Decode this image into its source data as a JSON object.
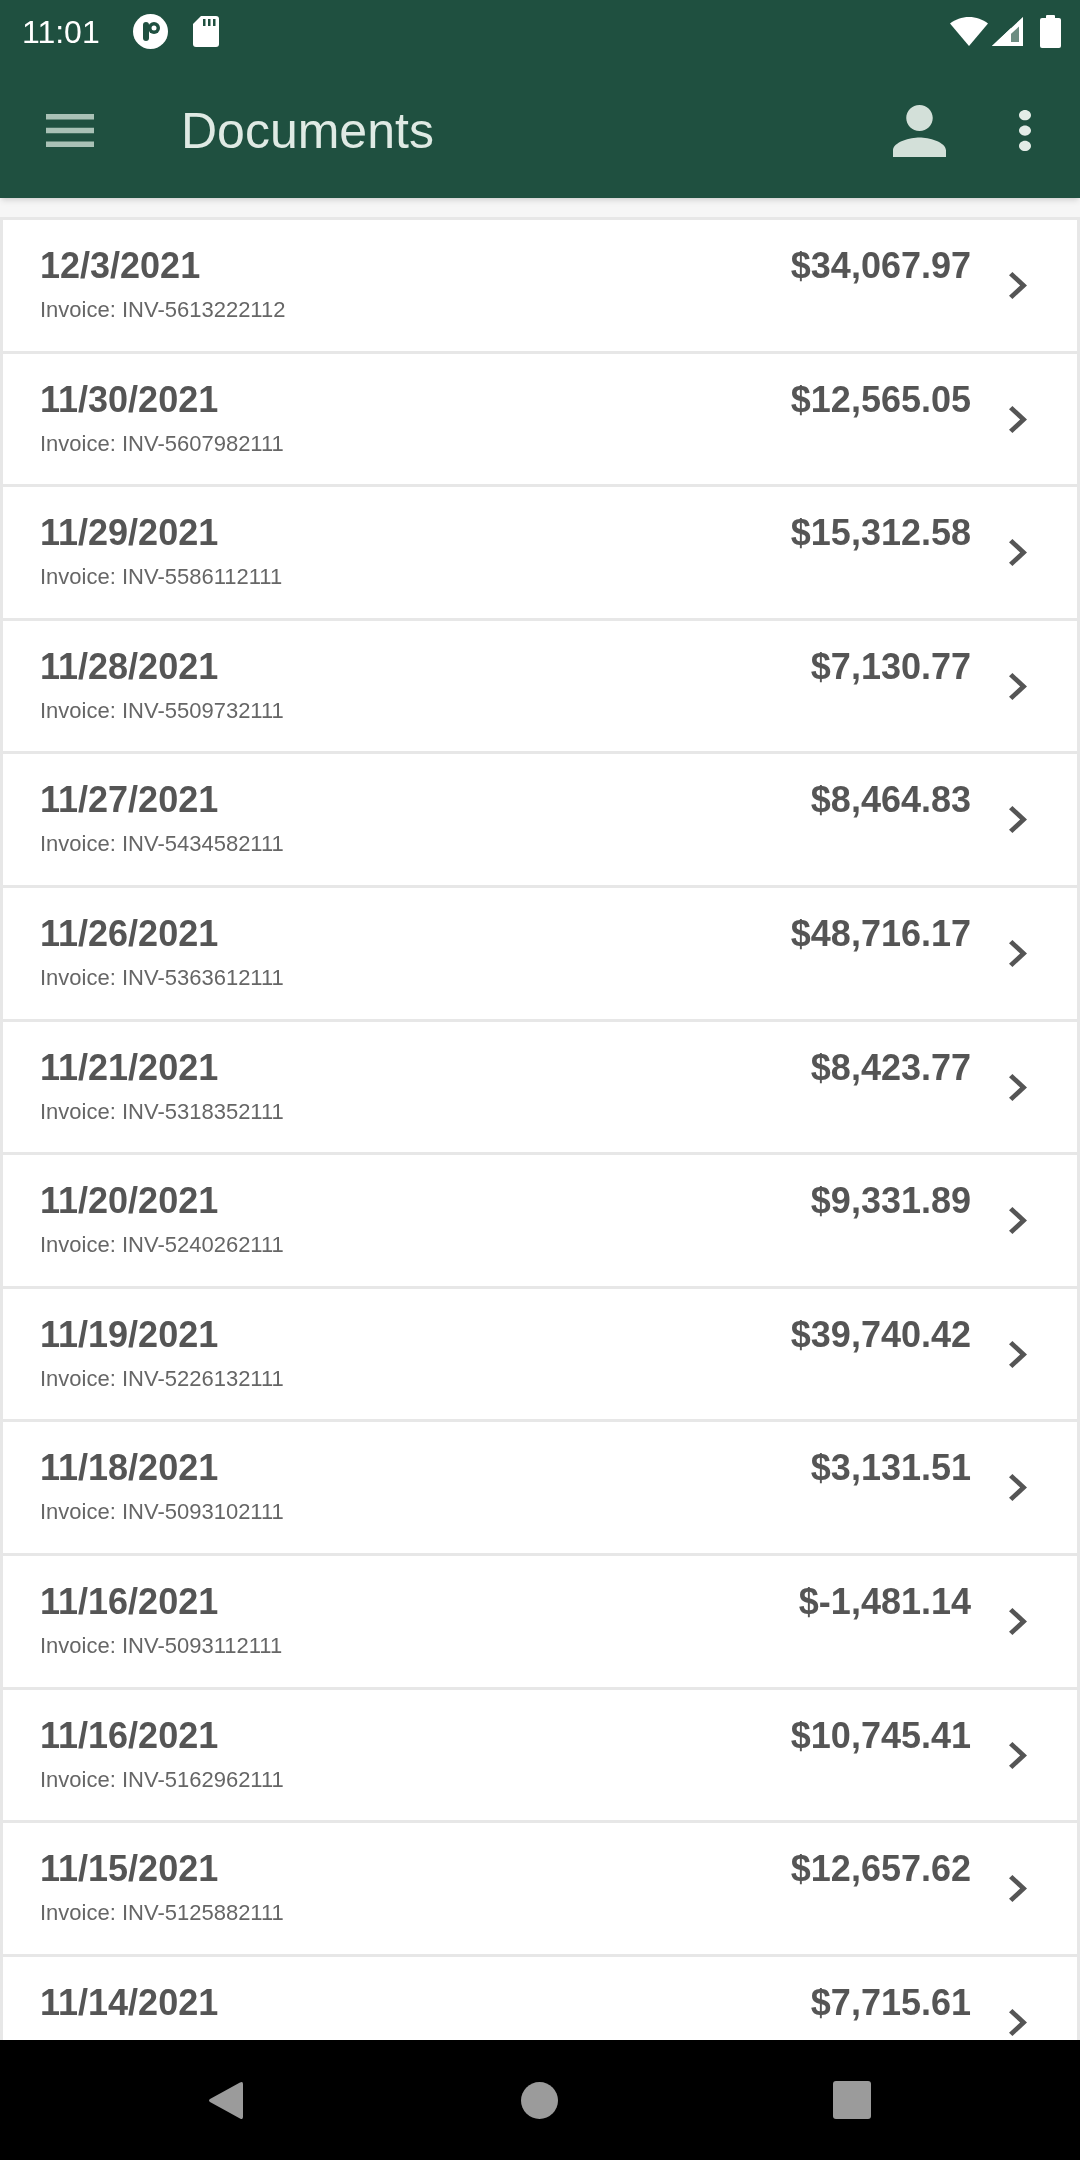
{
  "status_bar": {
    "time": "11:01"
  },
  "app_bar": {
    "title": "Documents"
  },
  "documents": [
    {
      "date": "12/3/2021",
      "amount": "$34,067.97",
      "invoice": "Invoice: INV-5613222112"
    },
    {
      "date": "11/30/2021",
      "amount": "$12,565.05",
      "invoice": "Invoice: INV-5607982111"
    },
    {
      "date": "11/29/2021",
      "amount": "$15,312.58",
      "invoice": "Invoice: INV-5586112111"
    },
    {
      "date": "11/28/2021",
      "amount": "$7,130.77",
      "invoice": "Invoice: INV-5509732111"
    },
    {
      "date": "11/27/2021",
      "amount": "$8,464.83",
      "invoice": "Invoice: INV-5434582111"
    },
    {
      "date": "11/26/2021",
      "amount": "$48,716.17",
      "invoice": "Invoice: INV-5363612111"
    },
    {
      "date": "11/21/2021",
      "amount": "$8,423.77",
      "invoice": "Invoice: INV-5318352111"
    },
    {
      "date": "11/20/2021",
      "amount": "$9,331.89",
      "invoice": "Invoice: INV-5240262111"
    },
    {
      "date": "11/19/2021",
      "amount": "$39,740.42",
      "invoice": "Invoice: INV-5226132111"
    },
    {
      "date": "11/18/2021",
      "amount": "$3,131.51",
      "invoice": "Invoice: INV-5093102111"
    },
    {
      "date": "11/16/2021",
      "amount": "$-1,481.14",
      "invoice": "Invoice: INV-5093112111"
    },
    {
      "date": "11/16/2021",
      "amount": "$10,745.41",
      "invoice": "Invoice: INV-5162962111"
    },
    {
      "date": "11/15/2021",
      "amount": "$12,657.62",
      "invoice": "Invoice: INV-5125882111"
    },
    {
      "date": "11/14/2021",
      "amount": "$7,715.61"
    }
  ]
}
